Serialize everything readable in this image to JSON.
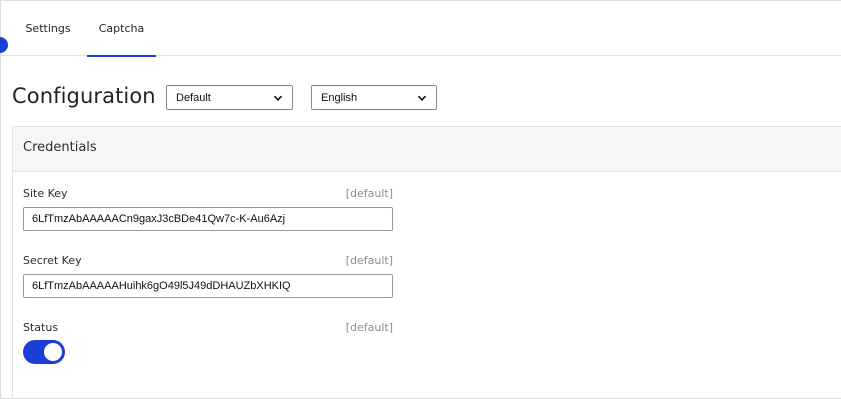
{
  "tabs": [
    {
      "label": "Settings",
      "active": false
    },
    {
      "label": "Captcha",
      "active": true
    }
  ],
  "header": {
    "title": "Configuration",
    "scope_select": {
      "selected": "Default"
    },
    "language_select": {
      "selected": "English"
    }
  },
  "credentials": {
    "title": "Credentials",
    "site_key": {
      "label": "Site Key",
      "scope": "[default]",
      "value": "6LfTmzAbAAAAACn9gaxJ3cBDe41Qw7c-K-Au6Azj"
    },
    "secret_key": {
      "label": "Secret Key",
      "scope": "[default]",
      "value": "6LfTmzAbAAAAAHuihk6gO49l5J49dDHAUZbXHKIQ"
    },
    "status": {
      "label": "Status",
      "scope": "[default]",
      "enabled": true
    }
  },
  "colors": {
    "accent": "#1a3fd6",
    "panel_bg": "#f6f6f7",
    "scope_text": "#8a8d91"
  }
}
